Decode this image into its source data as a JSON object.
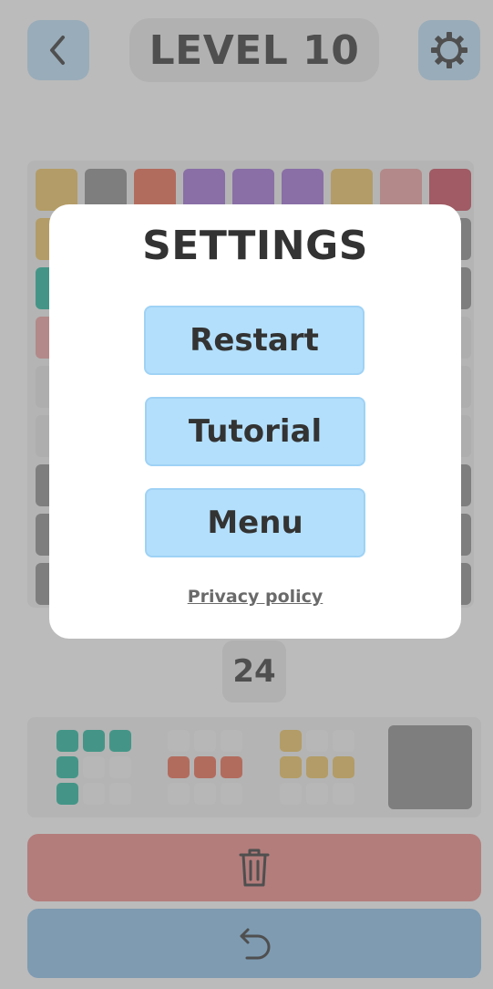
{
  "header": {
    "level_title": "LEVEL 10",
    "back_icon": "chevron-left-icon",
    "settings_icon": "gear-icon",
    "button_color": "#bfe3fb"
  },
  "board": {
    "cols": 9,
    "top_row_colors": [
      "#f0c560",
      "#8c8c8c",
      "#ef6b50",
      "#a070d8",
      "#a070d8",
      "#a070d8",
      "#f0c560",
      "#f0a0a0",
      "#cc4a5c"
    ],
    "left_column_colors": [
      "#f0c560",
      "#1fb89e",
      "#f0a0a0",
      "#e6e6e6",
      "#e6e6e6",
      "#8c8c8c",
      "#8c8c8c",
      "#8c8c8c"
    ],
    "right_column_colors": [
      "#8c8c8c",
      "#8c8c8c",
      "#e6e6e6",
      "#e6e6e6",
      "#e6e6e6",
      "#8c8c8c",
      "#8c8c8c",
      "#8c8c8c"
    ]
  },
  "moves": {
    "count": "24"
  },
  "pieces": [
    {
      "name": "teal-corner-piece",
      "color": "#1fb89e"
    },
    {
      "name": "red-line-piece",
      "color": "#ef6b50"
    },
    {
      "name": "yellow-t-piece",
      "color": "#f0c560"
    },
    {
      "name": "gray-block-piece",
      "color": "#8c8c8c"
    }
  ],
  "actions": {
    "delete_icon": "trash-icon",
    "delete_color": "#f08a88",
    "undo_icon": "undo-icon",
    "undo_color": "#8cc2ee"
  },
  "settings_modal": {
    "title": "SETTINGS",
    "restart_label": "Restart",
    "tutorial_label": "Tutorial",
    "menu_label": "Menu",
    "privacy_label": "Privacy policy",
    "button_color": "#b3dffc"
  }
}
